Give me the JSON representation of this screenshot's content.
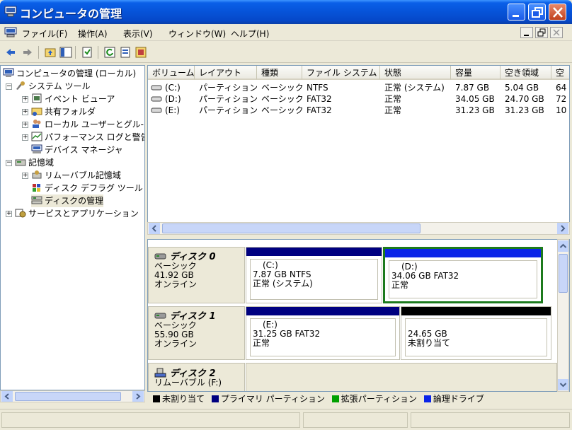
{
  "window": {
    "title": "コンピュータの管理"
  },
  "menu": [
    "ファイル(F)",
    "操作(A)",
    "表示(V)",
    "ウィンドウ(W)",
    "ヘルプ(H)"
  ],
  "tree": {
    "root": "コンピュータの管理 (ローカル)",
    "system_tools": "システム ツール",
    "event_viewer": "イベント ビューア",
    "shared_folders": "共有フォルダ",
    "local_users": "ローカル ユーザーとグル-",
    "performance_logs": "パフォーマンス ログと警告",
    "device_manager": "デバイス マネージャ",
    "storage": "記憶域",
    "removable_storage": "リムーバブル記憶域",
    "disk_defrag": "ディスク デフラグ ツール",
    "disk_management": "ディスクの管理",
    "services_apps": "サービスとアプリケーション"
  },
  "volume_list": {
    "columns": [
      "ボリューム",
      "レイアウト",
      "種類",
      "ファイル システム",
      "状態",
      "容量",
      "空き領域",
      "空"
    ],
    "rows": [
      [
        "(C:)",
        "パーティション",
        "ベーシック",
        "NTFS",
        "正常 (システム)",
        "7.87 GB",
        "5.04 GB",
        "64"
      ],
      [
        "(D:)",
        "パーティション",
        "ベーシック",
        "FAT32",
        "正常",
        "34.05 GB",
        "24.70 GB",
        "72"
      ],
      [
        "(E:)",
        "パーティション",
        "ベーシック",
        "FAT32",
        "正常",
        "31.23 GB",
        "31.23 GB",
        "10"
      ]
    ]
  },
  "disks": [
    {
      "name": "ディスク 0",
      "type": "ベーシック",
      "size": "41.92 GB",
      "status": "オンライン",
      "partitions": [
        {
          "label": "(C:)",
          "detail": "7.87 GB NTFS",
          "status": "正常 (システム)"
        },
        {
          "label": "(D:)",
          "detail": "34.06 GB FAT32",
          "status": "正常"
        }
      ]
    },
    {
      "name": "ディスク 1",
      "type": "ベーシック",
      "size": "55.90 GB",
      "status": "オンライン",
      "partitions": [
        {
          "label": "(E:)",
          "detail": "31.25 GB FAT32",
          "status": "正常"
        },
        {
          "label": "",
          "detail": "24.65 GB",
          "status": "未割り当て"
        }
      ]
    },
    {
      "name": "ディスク 2",
      "type": "リムーバブル (F:)"
    }
  ],
  "legend": [
    "未割り当て",
    "プライマリ パーティション",
    "拡張パーティション",
    "論理ドライブ"
  ],
  "colors": {
    "primary": "#000080",
    "logical": "#0a24e8",
    "extended": "#00a000",
    "unallocated": "#000000",
    "selection": "#1c7a1c"
  }
}
